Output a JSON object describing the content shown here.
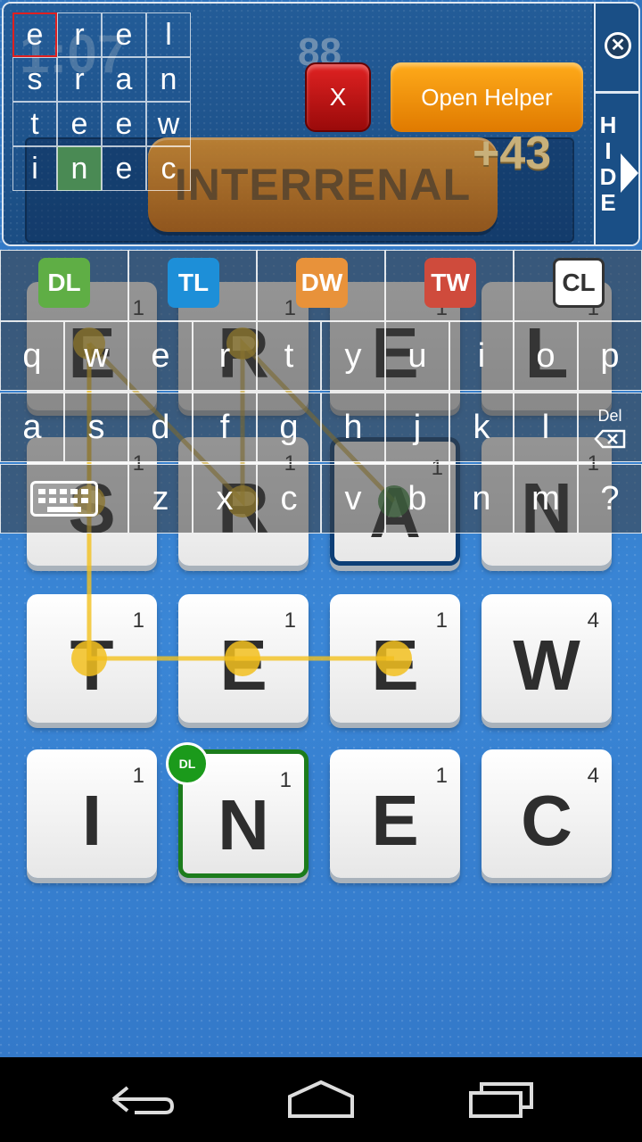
{
  "top_panel": {
    "timer": "1:07",
    "score": "88",
    "found_word": "INTERRENAL",
    "plus_score": "+43",
    "x_button_label": "X",
    "helper_button_label": "Open Helper",
    "close_icon": "close-icon",
    "hide_label": [
      "H",
      "I",
      "D",
      "E"
    ]
  },
  "mini_grid": [
    [
      "e",
      "r",
      "e",
      "l"
    ],
    [
      "s",
      "r",
      "a",
      "n"
    ],
    [
      "t",
      "e",
      "e",
      "w"
    ],
    [
      "i",
      "n",
      "e",
      "c"
    ]
  ],
  "board": [
    [
      {
        "l": "E",
        "p": "1"
      },
      {
        "l": "R",
        "p": "1"
      },
      {
        "l": "E",
        "p": "1"
      },
      {
        "l": "L",
        "p": "1"
      }
    ],
    [
      {
        "l": "S",
        "p": "1"
      },
      {
        "l": "R",
        "p": "1"
      },
      {
        "l": "A",
        "p": "1"
      },
      {
        "l": "N",
        "p": "1"
      }
    ],
    [
      {
        "l": "T",
        "p": "1"
      },
      {
        "l": "E",
        "p": "1"
      },
      {
        "l": "E",
        "p": "1"
      },
      {
        "l": "W",
        "p": "4"
      }
    ],
    [
      {
        "l": "I",
        "p": "1"
      },
      {
        "l": "N",
        "p": "1"
      },
      {
        "l": "E",
        "p": "1"
      },
      {
        "l": "C",
        "p": "4"
      }
    ]
  ],
  "badges": {
    "dl": "DL",
    "tl": "TL"
  },
  "bonus_keys": [
    {
      "label": "DL",
      "color": "#5fae45"
    },
    {
      "label": "TL",
      "color": "#1d8fd8"
    },
    {
      "label": "DW",
      "color": "#e8923a"
    },
    {
      "label": "TW",
      "color": "#cf4b3c"
    },
    {
      "label": "CL",
      "color": "#ffffff"
    }
  ],
  "keyboard": {
    "row1": [
      "q",
      "w",
      "e",
      "r",
      "t",
      "y",
      "u",
      "i",
      "o",
      "p"
    ],
    "row2": [
      "a",
      "s",
      "d",
      "f",
      "g",
      "h",
      "j",
      "k",
      "l"
    ],
    "row3": [
      "z",
      "x",
      "c",
      "v",
      "b",
      "n",
      "m",
      "?"
    ],
    "del_label": "Del"
  }
}
